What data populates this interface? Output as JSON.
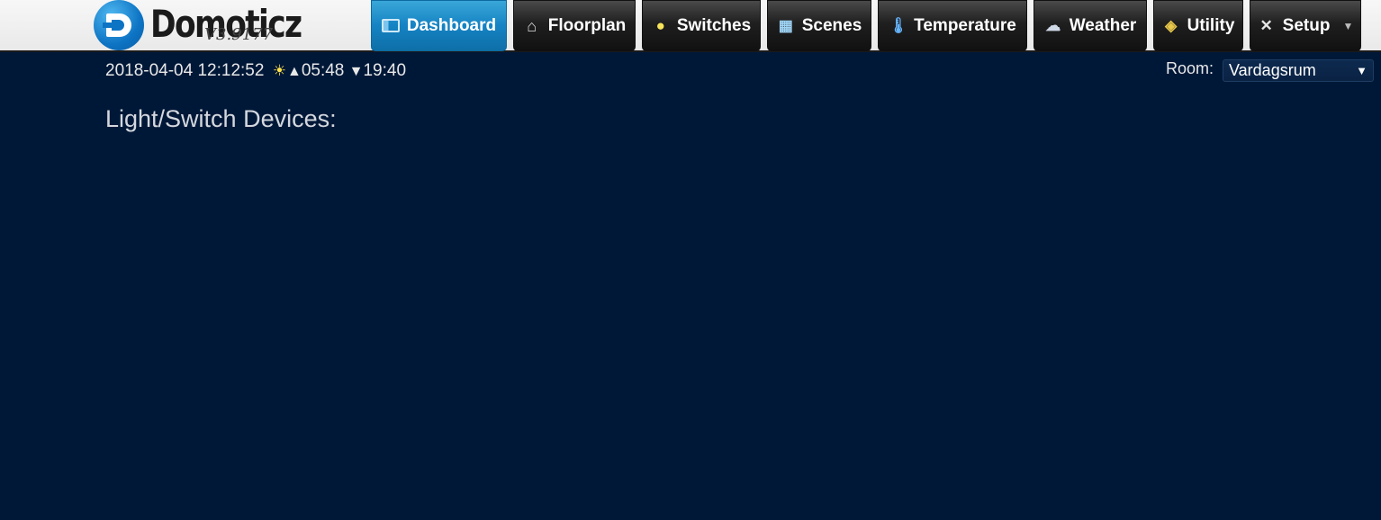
{
  "app": {
    "logo_text": "Domoticz",
    "version": "V3.9177"
  },
  "nav": {
    "items": [
      {
        "label": "Dashboard",
        "icon": "dashboard-icon",
        "active": true
      },
      {
        "label": "Floorplan",
        "icon": "house-icon"
      },
      {
        "label": "Switches",
        "icon": "lightbulb-icon"
      },
      {
        "label": "Scenes",
        "icon": "clapperboard-icon"
      },
      {
        "label": "Temperature",
        "icon": "thermometer-icon"
      },
      {
        "label": "Weather",
        "icon": "rain-cloud-icon"
      },
      {
        "label": "Utility",
        "icon": "utility-icon"
      },
      {
        "label": "Setup",
        "icon": "tools-icon",
        "has_dropdown": true
      }
    ]
  },
  "status": {
    "datetime": "2018-04-04 12:12:52",
    "sunrise": "05:48",
    "sunset": "19:40"
  },
  "room": {
    "label": "Room:",
    "selected": "Vardagsrum"
  },
  "main": {
    "section_title": "Light/Switch Devices:"
  },
  "colors": {
    "background": "#001838",
    "active_tab": "#1583c3",
    "tab": "#1f1f1f"
  }
}
